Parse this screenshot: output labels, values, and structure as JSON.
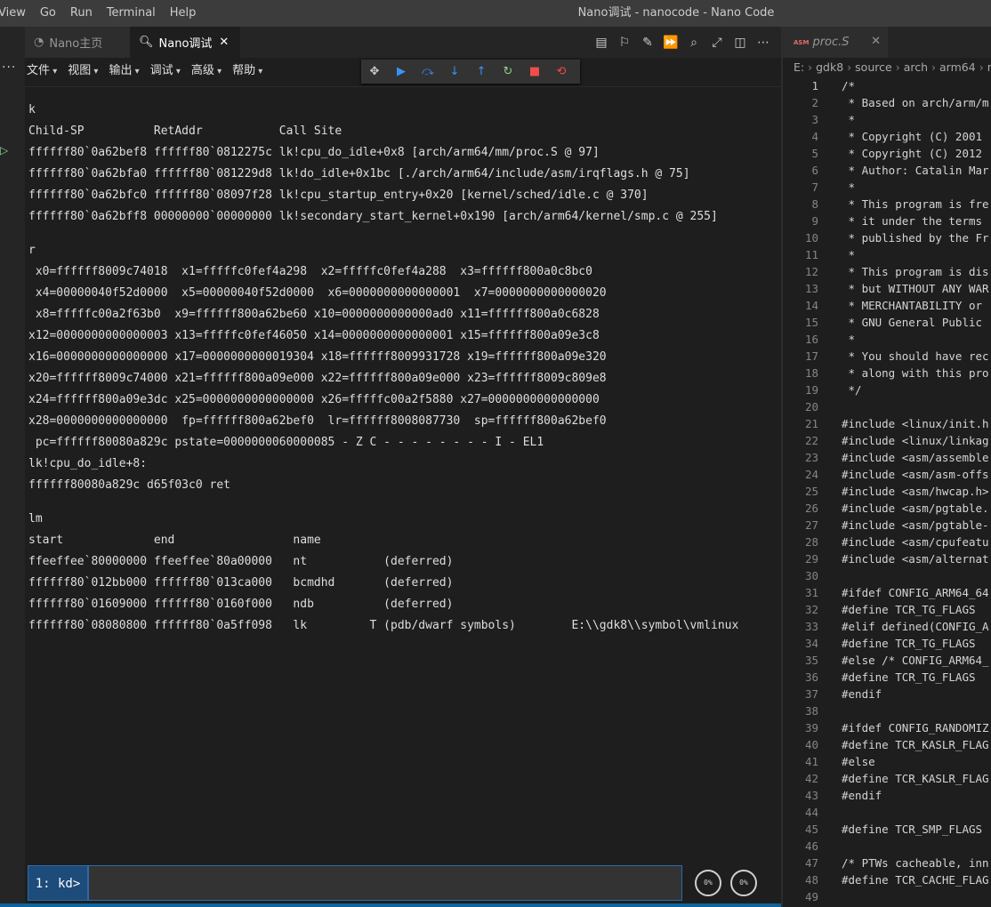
{
  "menubar": [
    "View",
    "Go",
    "Run",
    "Terminal",
    "Help"
  ],
  "window_title": "Nano调试 - nanocode - Nano Code",
  "tabs": [
    {
      "label": "Nano主页",
      "icon": "gauge-icon"
    },
    {
      "label": "Nano调试",
      "icon": "search-icon"
    }
  ],
  "editor_actions": [
    "book-icon",
    "bookmark-icon",
    "clean-icon",
    "fast-forward-icon",
    "zoom-icon",
    "expand-icon",
    "split-editor-icon",
    "more-icon"
  ],
  "app_menu": [
    "文件",
    "视图",
    "输出",
    "调试",
    "高级",
    "帮助"
  ],
  "debug_toolbar": [
    {
      "icon": "drag-handle-icon",
      "glyph": "✥",
      "color": "#cccccc"
    },
    {
      "icon": "continue-icon",
      "glyph": "▶",
      "color": "#3794ff"
    },
    {
      "icon": "step-over-icon",
      "glyph": "⤼",
      "color": "#3794ff"
    },
    {
      "icon": "step-into-icon",
      "glyph": "↓",
      "color": "#3794ff"
    },
    {
      "icon": "step-out-icon",
      "glyph": "↑",
      "color": "#3794ff"
    },
    {
      "icon": "restart-icon",
      "glyph": "↻",
      "color": "#89d185"
    },
    {
      "icon": "stop-icon",
      "glyph": "■",
      "color": "#f14c4c"
    },
    {
      "icon": "disconnect-icon",
      "glyph": "⟲",
      "color": "#f14c4c"
    }
  ],
  "console": {
    "blocks": [
      [
        "k",
        "Child-SP          RetAddr           Call Site",
        "ffffff80`0a62bef8 ffffff80`0812275c lk!cpu_do_idle+0x8 [arch/arm64/mm/proc.S @ 97]",
        "ffffff80`0a62bfa0 ffffff80`081229d8 lk!do_idle+0x1bc [./arch/arm64/include/asm/irqflags.h @ 75]",
        "ffffff80`0a62bfc0 ffffff80`08097f28 lk!cpu_startup_entry+0x20 [kernel/sched/idle.c @ 370]",
        "ffffff80`0a62bff8 00000000`00000000 lk!secondary_start_kernel+0x190 [arch/arm64/kernel/smp.c @ 255]"
      ],
      [
        "r",
        " x0=ffffff8009c74018  x1=fffffc0fef4a298  x2=fffffc0fef4a288  x3=ffffff800a0c8bc0",
        " x4=00000040f52d0000  x5=00000040f52d0000  x6=0000000000000001  x7=0000000000000020",
        " x8=fffffc00a2f63b0  x9=ffffff800a62be60 x10=0000000000000ad0 x11=ffffff800a0c6828",
        "x12=0000000000000003 x13=fffffc0fef46050 x14=0000000000000001 x15=ffffff800a09e3c8",
        "x16=0000000000000000 x17=0000000000019304 x18=ffffff8009931728 x19=ffffff800a09e320",
        "x20=ffffff8009c74000 x21=ffffff800a09e000 x22=ffffff800a09e000 x23=ffffff8009c809e8",
        "x24=ffffff800a09e3dc x25=0000000000000000 x26=fffffc00a2f5880 x27=0000000000000000",
        "x28=0000000000000000  fp=ffffff800a62bef0  lr=ffffff8008087730  sp=ffffff800a62bef0",
        " pc=ffffff80080a829c pstate=0000000060000085 - Z C - - - - - - - - I - EL1",
        "lk!cpu_do_idle+8:",
        "ffffff80080a829c d65f03c0 ret"
      ],
      [
        "lm",
        "start             end                 name",
        "ffeeffee`80000000 ffeeffee`80a00000   nt           (deferred)",
        "ffffff80`012bb000 ffffff80`013ca000   bcmdhd       (deferred)",
        "ffffff80`01609000 ffffff80`0160f000   ndb          (deferred)",
        "ffffff80`08080800 ffffff80`0a5ff098   lk         T (pdb/dwarf symbols)        E:\\\\gdk8\\\\symbol\\vmlinux"
      ]
    ]
  },
  "command": {
    "prompt": "1: kd>",
    "value": ""
  },
  "gauges": [
    {
      "name": "cpu",
      "label": "0%"
    },
    {
      "name": "memory",
      "label": "0%"
    }
  ],
  "right_editor": {
    "tab": {
      "file": "proc.S",
      "badge": "ASM"
    },
    "breadcrumb": [
      "E:",
      "gdk8",
      "source",
      "arch",
      "arm64",
      "m"
    ],
    "current_line": 1,
    "lines": [
      "/*",
      " * Based on arch/arm/m",
      " *",
      " * Copyright (C) 2001",
      " * Copyright (C) 2012",
      " * Author: Catalin Mar",
      " *",
      " * This program is fre",
      " * it under the terms ",
      " * published by the Fr",
      " *",
      " * This program is dis",
      " * but WITHOUT ANY WAR",
      " * MERCHANTABILITY or ",
      " * GNU General Public ",
      " *",
      " * You should have rec",
      " * along with this pro",
      " */",
      "",
      "#include <linux/init.h",
      "#include <linux/linkag",
      "#include <asm/assemble",
      "#include <asm/asm-offs",
      "#include <asm/hwcap.h>",
      "#include <asm/pgtable.",
      "#include <asm/pgtable-",
      "#include <asm/cpufeatu",
      "#include <asm/alternat",
      "",
      "#ifdef CONFIG_ARM64_64",
      "#define TCR_TG_FLAGS",
      "#elif defined(CONFIG_A",
      "#define TCR_TG_FLAGS",
      "#else /* CONFIG_ARM64_",
      "#define TCR_TG_FLAGS",
      "#endif",
      "",
      "#ifdef CONFIG_RANDOMIZ",
      "#define TCR_KASLR_FLAG",
      "#else",
      "#define TCR_KASLR_FLAG",
      "#endif",
      "",
      "#define TCR_SMP_FLAGS",
      "",
      "/* PTWs cacheable, inn",
      "#define TCR_CACHE_FLAG",
      ""
    ]
  }
}
